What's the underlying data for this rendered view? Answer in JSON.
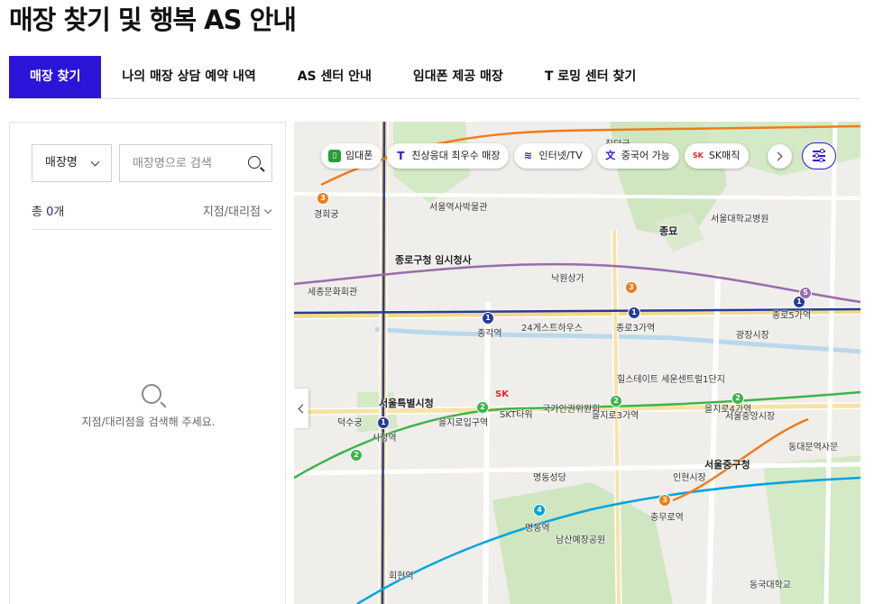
{
  "page": {
    "title": "매장 찾기 및 행복 AS 안내"
  },
  "tabs": [
    {
      "label": "매장 찾기",
      "active": true
    },
    {
      "label": "나의 매장 상담 예약 내역",
      "active": false
    },
    {
      "label": "AS 센터 안내",
      "active": false
    },
    {
      "label": "임대폰 제공 매장",
      "active": false
    },
    {
      "label": "T 로밍 센터 찾기",
      "active": false
    }
  ],
  "search": {
    "type_selected": "매장명",
    "placeholder": "매장명으로 검색",
    "value": ""
  },
  "results": {
    "count_prefix": "총 ",
    "count": "0",
    "count_suffix": "개",
    "sort_label": "지점/대리점",
    "empty_message": "지점/대리점을 검색해 주세요."
  },
  "map": {
    "filters": [
      {
        "label": "임대폰",
        "icon": "phone-icon",
        "color": "#2a9d3a"
      },
      {
        "label": "친상응대 최우수 매장",
        "icon": "t-logo-icon",
        "color": "#2b15d8"
      },
      {
        "label": "인터넷/TV",
        "icon": "router-icon",
        "color": "#2b15d8"
      },
      {
        "label": "중국어 가능",
        "icon": "translate-icon",
        "color": "#2b15d8"
      },
      {
        "label": "SK매직",
        "icon": "sk-logo-icon",
        "color": "#e6262d"
      }
    ],
    "sk_label": "SK",
    "labels": [
      {
        "text": "경희궁",
        "w": false
      },
      {
        "text": "서울역사박물관",
        "w": false
      },
      {
        "text": "종로구청 임시청사",
        "w": true
      },
      {
        "text": "서울특별시청",
        "w": true
      },
      {
        "text": "시청역",
        "w": false
      },
      {
        "text": "종각역",
        "w": false
      },
      {
        "text": "을지로입구역",
        "w": false
      },
      {
        "text": "을지로3가역",
        "w": false
      },
      {
        "text": "종로3가역",
        "w": false
      },
      {
        "text": "종로5가역",
        "w": false
      },
      {
        "text": "종묘",
        "w": false
      },
      {
        "text": "서울중구청",
        "w": true
      },
      {
        "text": "명동역",
        "w": false
      },
      {
        "text": "충무로역",
        "w": false
      },
      {
        "text": "회현역",
        "w": false
      },
      {
        "text": "국가인권위원회",
        "w": false
      },
      {
        "text": "SKT타워",
        "w": false
      },
      {
        "text": "을지로4가역",
        "w": false
      },
      {
        "text": "서울대학교병원",
        "w": false
      },
      {
        "text": "덕수궁",
        "w": false
      },
      {
        "text": "남산예장공원",
        "w": false
      },
      {
        "text": "동국대학교",
        "w": false
      },
      {
        "text": "24게스트하우스",
        "w": false
      },
      {
        "text": "힐스테이트 세운센트럴1단지",
        "w": false
      },
      {
        "text": "광장시장",
        "w": false
      },
      {
        "text": "동대문역사문",
        "w": false
      },
      {
        "text": "서울중앙시장",
        "w": false
      },
      {
        "text": "명동성당",
        "w": false
      },
      {
        "text": "인현시장",
        "w": false
      },
      {
        "text": "창덕궁",
        "w": false
      },
      {
        "text": "세종문화회관",
        "w": false
      },
      {
        "text": "낙원상가",
        "w": false
      }
    ]
  }
}
